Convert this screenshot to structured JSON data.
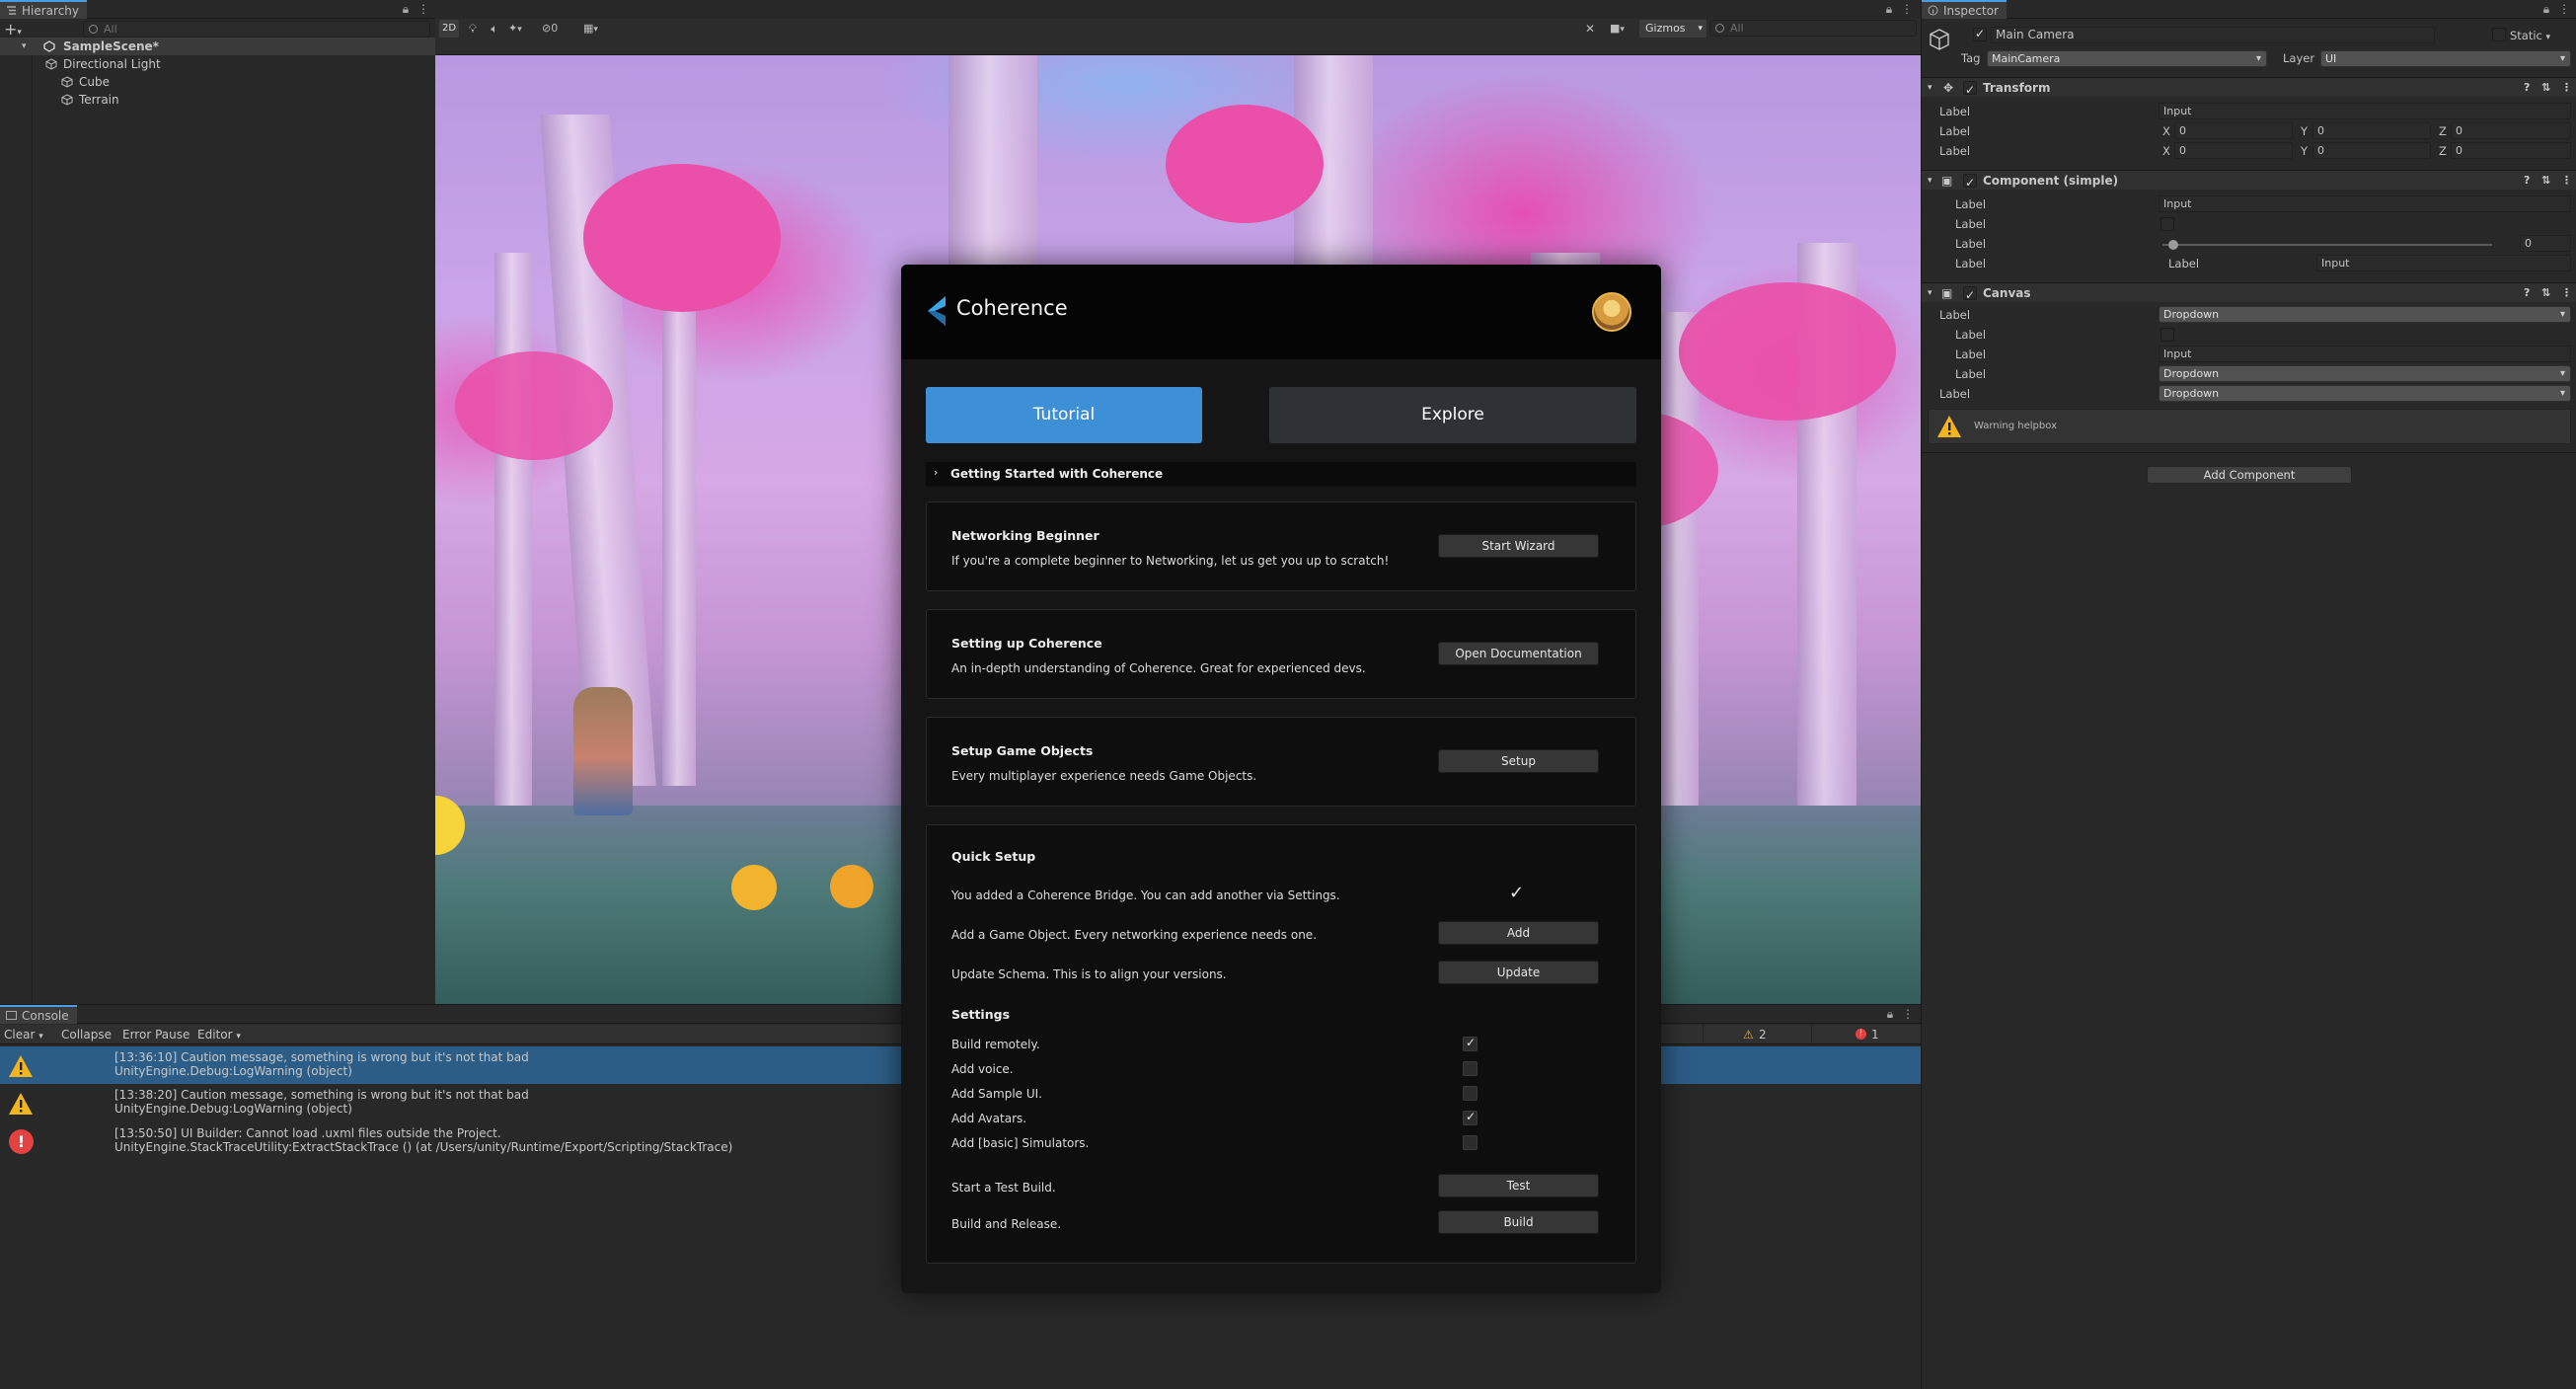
{
  "hierarchy": {
    "tab": "Hierarchy",
    "add": "+",
    "search_placeholder": "All",
    "items": [
      {
        "label": "SampleScene*",
        "bold": true
      },
      {
        "label": "Directional Light"
      },
      {
        "label": "Cube"
      },
      {
        "label": "Terrain"
      }
    ]
  },
  "scene": {
    "toolbar": {
      "mode_2d": "2D",
      "gizmos": "Gizmos",
      "fx_count": "0",
      "search_placeholder": "All"
    }
  },
  "inspector": {
    "tab": "Inspector",
    "object_name": "Main Camera",
    "static_label": "Static",
    "tag_label": "Tag",
    "tag_value": "MainCamera",
    "layer_label": "Layer",
    "layer_value": "UI",
    "transform": {
      "title": "Transform",
      "rows": [
        {
          "label": "Label",
          "value": "Input"
        },
        {
          "label": "Label",
          "x": "0",
          "y": "0",
          "z": "0"
        },
        {
          "label": "Label",
          "x": "0",
          "y": "0",
          "z": "0"
        }
      ],
      "axis": [
        "X",
        "Y",
        "Z"
      ]
    },
    "simple": {
      "title": "Component (simple)",
      "rows": [
        {
          "label": "Label",
          "value": "Input"
        },
        {
          "label": "Label"
        },
        {
          "label": "Label",
          "slider_value": "0",
          "slider_fraction": 0.02
        },
        {
          "label": "Label",
          "sublabel": "Label",
          "value": "Input"
        }
      ]
    },
    "canvas": {
      "title": "Canvas",
      "rows": [
        {
          "label": "Label",
          "value": "Dropdown"
        },
        {
          "label": "Label"
        },
        {
          "label": "Label",
          "value": "Input"
        },
        {
          "label": "Label",
          "value": "Dropdown"
        },
        {
          "label": "Label",
          "value": "Dropdown"
        }
      ],
      "warning": "Warning helpbox"
    },
    "add_component": "Add Component"
  },
  "console": {
    "tab": "Console",
    "clear": "Clear",
    "collapse": "Collapse",
    "error_pause": "Error Pause",
    "editor": "Editor",
    "warn_count": "2",
    "error_count": "1",
    "messages": [
      {
        "type": "warning",
        "line1": "[13:36:10] Caution message, something is wrong but it's not that bad",
        "line2": "UnityEngine.Debug:LogWarning (object)",
        "selected": true
      },
      {
        "type": "warning",
        "line1": "[13:38:20] Caution message, something is wrong but it's not that bad",
        "line2": "UnityEngine.Debug:LogWarning (object)"
      },
      {
        "type": "error",
        "line1": "[13:50:50] UI Builder: Cannot load .uxml files outside the Project.",
        "line2": "UnityEngine.StackTraceUtility:ExtractStackTrace () (at /Users/unity/Runtime/Export/Scripting/StackTrace)"
      }
    ]
  },
  "modal": {
    "brand": "Coherence",
    "tabs": {
      "tutorial": "Tutorial",
      "explore": "Explore"
    },
    "getting_started": "Getting Started with Coherence",
    "cards": [
      {
        "title": "Networking Beginner",
        "text": "If you're a complete beginner to Networking, let us get you up to scratch!",
        "button": "Start Wizard"
      },
      {
        "title": "Setting up Coherence",
        "text": "An in-depth understanding of Coherence. Great for experienced devs.",
        "button": "Open Documentation"
      },
      {
        "title": "Setup Game Objects",
        "text": "Every multiplayer experience needs Game Objects.",
        "button": "Setup"
      }
    ],
    "quick": {
      "title": "Quick Setup",
      "bridge": "You added a Coherence Bridge. You can add another via Settings.",
      "add_go": "Add a Game Object. Every networking experience needs one.",
      "add_button": "Add",
      "schema": "Update Schema. This is to align your versions.",
      "update_button": "Update",
      "settings_title": "Settings",
      "settings": [
        {
          "label": "Build remotely.",
          "checked": true
        },
        {
          "label": "Add voice.",
          "checked": false
        },
        {
          "label": "Add Sample UI.",
          "checked": false
        },
        {
          "label": "Add Avatars.",
          "checked": true
        },
        {
          "label": "Add [basic] Simulators.",
          "checked": false
        }
      ],
      "test_label": "Start a Test Build.",
      "test_button": "Test",
      "build_label": "Build and Release.",
      "build_button": "Build"
    }
  },
  "colors": {
    "accent": "#3d8fd6",
    "warning": "#f4b51c",
    "error": "#e34242",
    "selection": "#2c5d87"
  }
}
